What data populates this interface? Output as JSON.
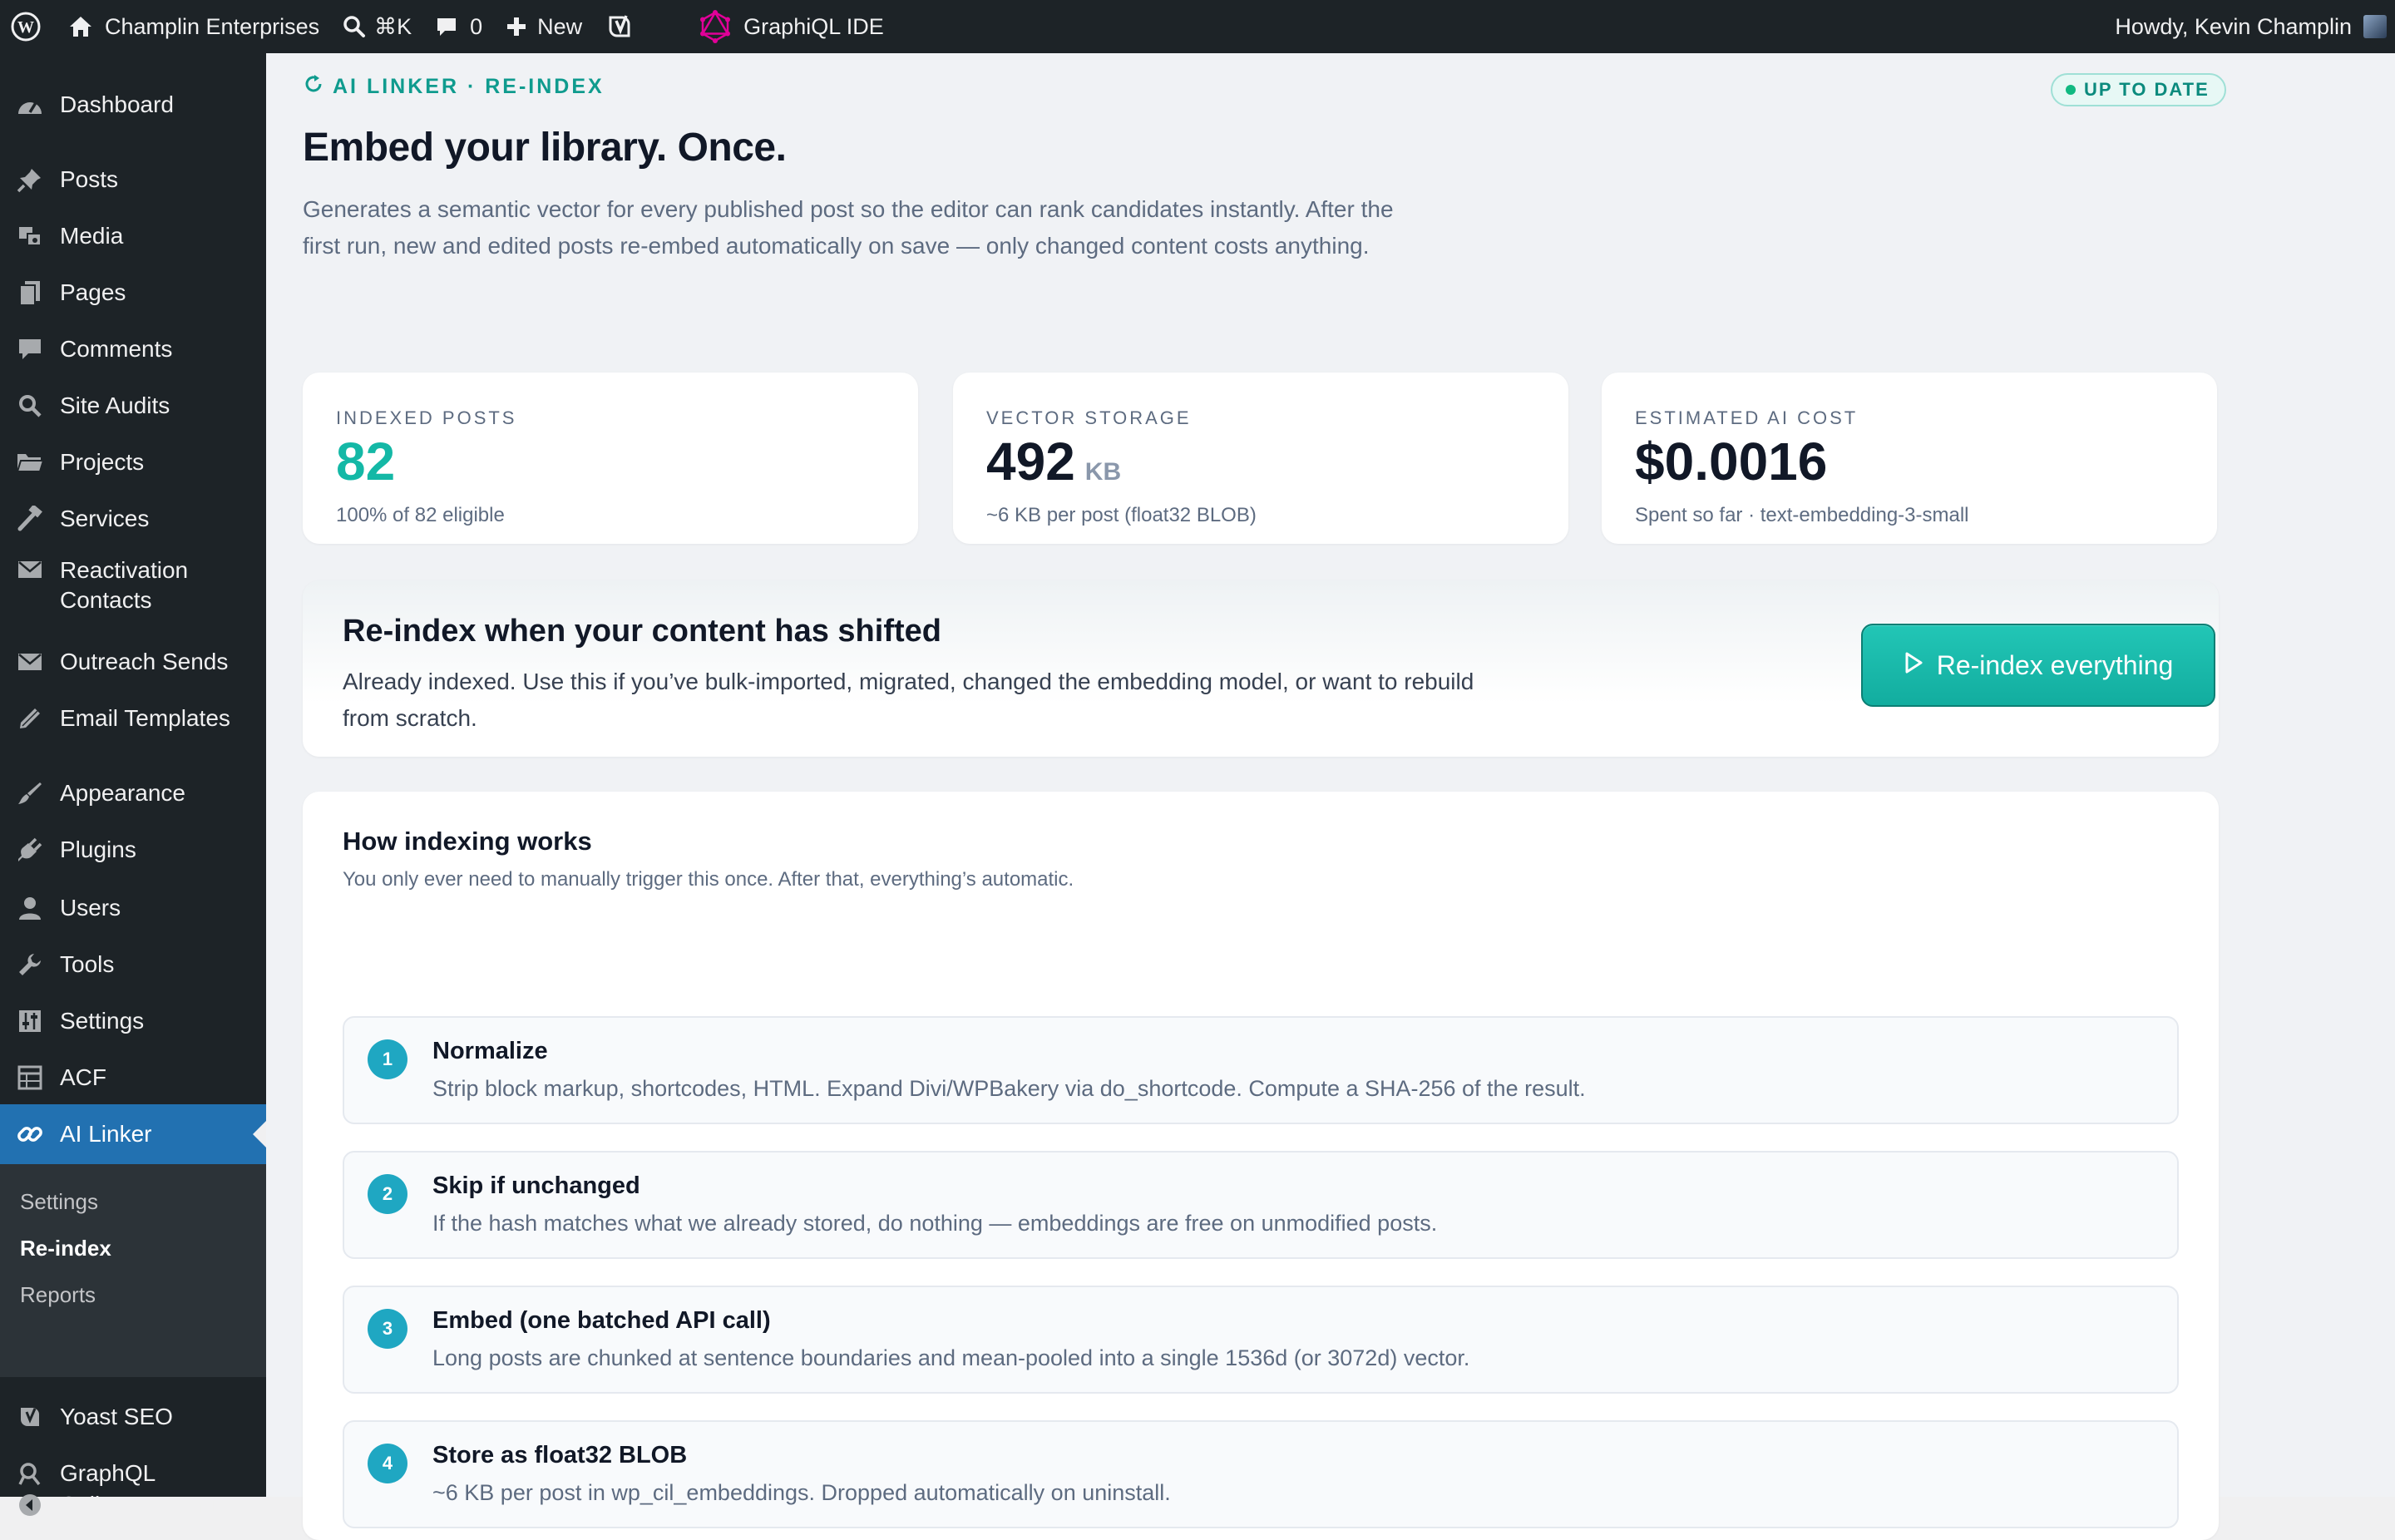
{
  "admin_bar": {
    "site_name": "Champlin Enterprises",
    "search_shortcut": "⌘K",
    "comments_count": "0",
    "new_label": "New",
    "graphiql_label": "GraphiQL IDE",
    "greeting": "Howdy, Kevin Champlin"
  },
  "sidebar": {
    "items": {
      "dashboard": "Dashboard",
      "posts": "Posts",
      "media": "Media",
      "pages": "Pages",
      "comments": "Comments",
      "site_audits": "Site Audits",
      "projects": "Projects",
      "services": "Services",
      "reactivation_line1": "Reactivation",
      "reactivation_line2": "Contacts",
      "outreach_sends": "Outreach Sends",
      "email_templates": "Email Templates",
      "appearance": "Appearance",
      "plugins": "Plugins",
      "users": "Users",
      "tools": "Tools",
      "settings": "Settings",
      "acf": "ACF",
      "ai_linker": "AI Linker",
      "yoast": "Yoast SEO",
      "graphql": "GraphQL",
      "collapse": "Collapse Menu"
    },
    "submenu": {
      "settings": "Settings",
      "reindex": "Re-index",
      "reports": "Reports"
    }
  },
  "header": {
    "eyebrow": "AI LINKER · RE-INDEX",
    "status": "UP TO DATE",
    "title": "Embed your library. Once.",
    "description": "Generates a semantic vector for every published post so the editor can rank candidates instantly. After the first run, new and edited posts re-embed automatically on save — only changed content costs anything."
  },
  "stats": [
    {
      "label": "INDEXED POSTS",
      "value": "82",
      "unit": "",
      "sub": "100% of 82 eligible"
    },
    {
      "label": "VECTOR STORAGE",
      "value": "492",
      "unit": "KB",
      "sub": "~6 KB per post (float32 BLOB)"
    },
    {
      "label": "ESTIMATED AI COST",
      "value": "$0.0016",
      "unit": "",
      "sub": "Spent so far · text-embedding-3-small"
    }
  ],
  "reindex": {
    "title": "Re-index when your content has shifted",
    "description": "Already indexed. Use this if you’ve bulk-imported, migrated, changed the embedding model, or want to rebuild from scratch.",
    "button_label": "Re-index everything"
  },
  "how": {
    "title": "How indexing works",
    "subtitle": "You only ever need to manually trigger this once. After that, everything’s automatic.",
    "steps": [
      {
        "num": "1",
        "title": "Normalize",
        "desc": "Strip block markup, shortcodes, HTML. Expand Divi/WPBakery via do_shortcode. Compute a SHA-256 of the result."
      },
      {
        "num": "2",
        "title": "Skip if unchanged",
        "desc": "If the hash matches what we already stored, do nothing — embeddings are free on unmodified posts."
      },
      {
        "num": "3",
        "title": "Embed (one batched API call)",
        "desc": "Long posts are chunked at sentence boundaries and mean-pooled into a single 1536d (or 3072d) vector."
      },
      {
        "num": "4",
        "title": "Store as float32 BLOB",
        "desc": "~6 KB per post in wp_cil_embeddings. Dropped automatically on uninstall."
      }
    ]
  },
  "colors": {
    "admin_bar_bg": "#1d2327",
    "current_menu": "#2271b1",
    "accent_teal": "#14b8a6",
    "step_badge": "#1fa7c2"
  }
}
